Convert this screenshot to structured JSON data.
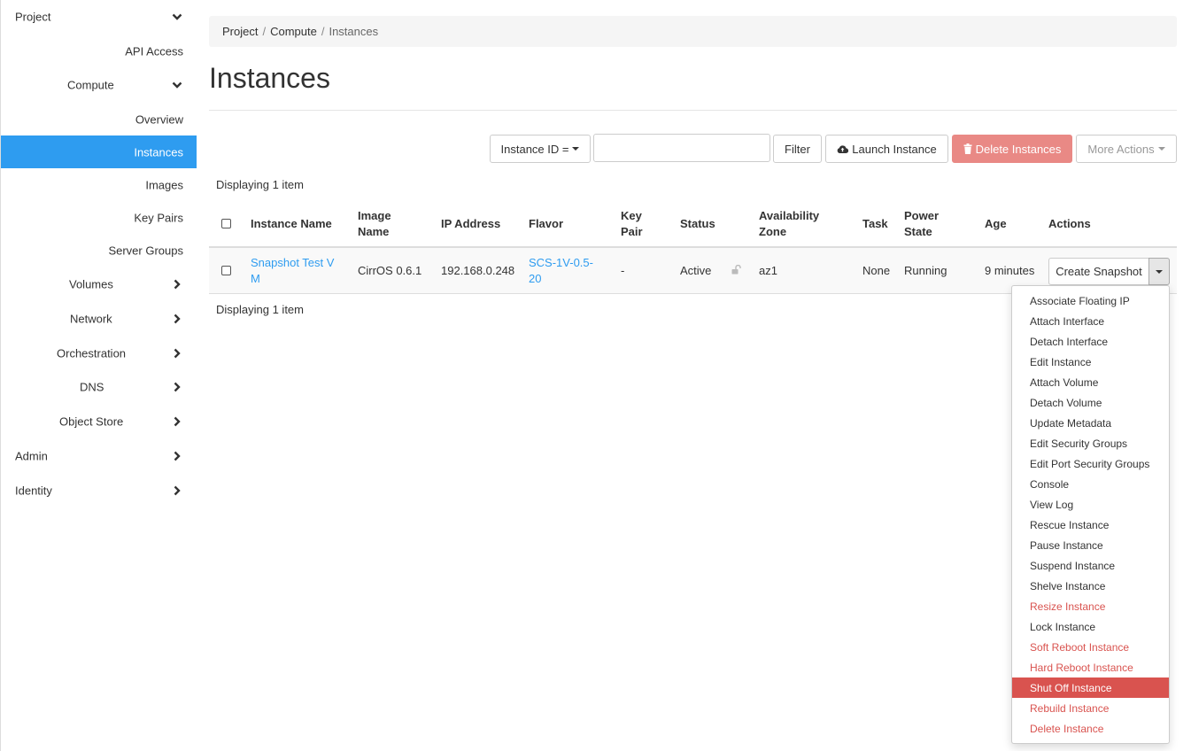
{
  "sidebar": {
    "items": [
      {
        "label": "Project",
        "chevron": "down"
      },
      {
        "label": "API Access"
      },
      {
        "label": "Compute",
        "chevron": "down"
      },
      {
        "label": "Overview"
      },
      {
        "label": "Instances",
        "active": true
      },
      {
        "label": "Images"
      },
      {
        "label": "Key Pairs"
      },
      {
        "label": "Server Groups"
      },
      {
        "label": "Volumes",
        "chevron": "right"
      },
      {
        "label": "Network",
        "chevron": "right"
      },
      {
        "label": "Orchestration",
        "chevron": "right"
      },
      {
        "label": "DNS",
        "chevron": "right"
      },
      {
        "label": "Object Store",
        "chevron": "right"
      },
      {
        "label": "Admin",
        "chevron": "right"
      },
      {
        "label": "Identity",
        "chevron": "right"
      }
    ]
  },
  "breadcrumb": [
    "Project",
    "Compute",
    "Instances"
  ],
  "page_title": "Instances",
  "toolbar": {
    "filter_field": "Instance ID =",
    "filter_value": "",
    "filter_label": "Filter",
    "launch_label": "Launch Instance",
    "delete_label": "Delete Instances",
    "more_label": "More Actions"
  },
  "displaying_text": "Displaying 1 item",
  "table": {
    "headers": {
      "name": "Instance Name",
      "image_1": "Image",
      "image_2": "Name",
      "ip": "IP Address",
      "flavor": "Flavor",
      "keypair_1": "Key",
      "keypair_2": "Pair",
      "status": "Status",
      "az_1": "Availability",
      "az_2": "Zone",
      "task": "Task",
      "power_1": "Power",
      "power_2": "State",
      "age": "Age",
      "actions": "Actions"
    },
    "row": {
      "name_1": "Snapshot Test V",
      "name_2": "M",
      "image": "CirrOS 0.6.1",
      "ip": "192.168.0.248",
      "flavor_1": "SCS-1V-0.5-",
      "flavor_2": "20",
      "keypair": "-",
      "status": "Active",
      "az": "az1",
      "task": "None",
      "power": "Running",
      "age": "9 minutes",
      "action_primary": "Create Snapshot"
    }
  },
  "actions_menu": [
    {
      "label": "Associate Floating IP"
    },
    {
      "label": "Attach Interface"
    },
    {
      "label": "Detach Interface"
    },
    {
      "label": "Edit Instance"
    },
    {
      "label": "Attach Volume"
    },
    {
      "label": "Detach Volume"
    },
    {
      "label": "Update Metadata"
    },
    {
      "label": "Edit Security Groups"
    },
    {
      "label": "Edit Port Security Groups"
    },
    {
      "label": "Console"
    },
    {
      "label": "View Log"
    },
    {
      "label": "Rescue Instance"
    },
    {
      "label": "Pause Instance"
    },
    {
      "label": "Suspend Instance"
    },
    {
      "label": "Shelve Instance"
    },
    {
      "label": "Resize Instance",
      "style": "danger"
    },
    {
      "label": "Lock Instance"
    },
    {
      "label": "Soft Reboot Instance",
      "style": "danger"
    },
    {
      "label": "Hard Reboot Instance",
      "style": "danger"
    },
    {
      "label": "Shut Off Instance",
      "style": "highlighted"
    },
    {
      "label": "Rebuild Instance",
      "style": "danger"
    },
    {
      "label": "Delete Instance",
      "style": "danger"
    }
  ],
  "colors": {
    "accent": "#2e9cf0",
    "danger": "#d9534f",
    "danger_button": "#e8837f"
  }
}
